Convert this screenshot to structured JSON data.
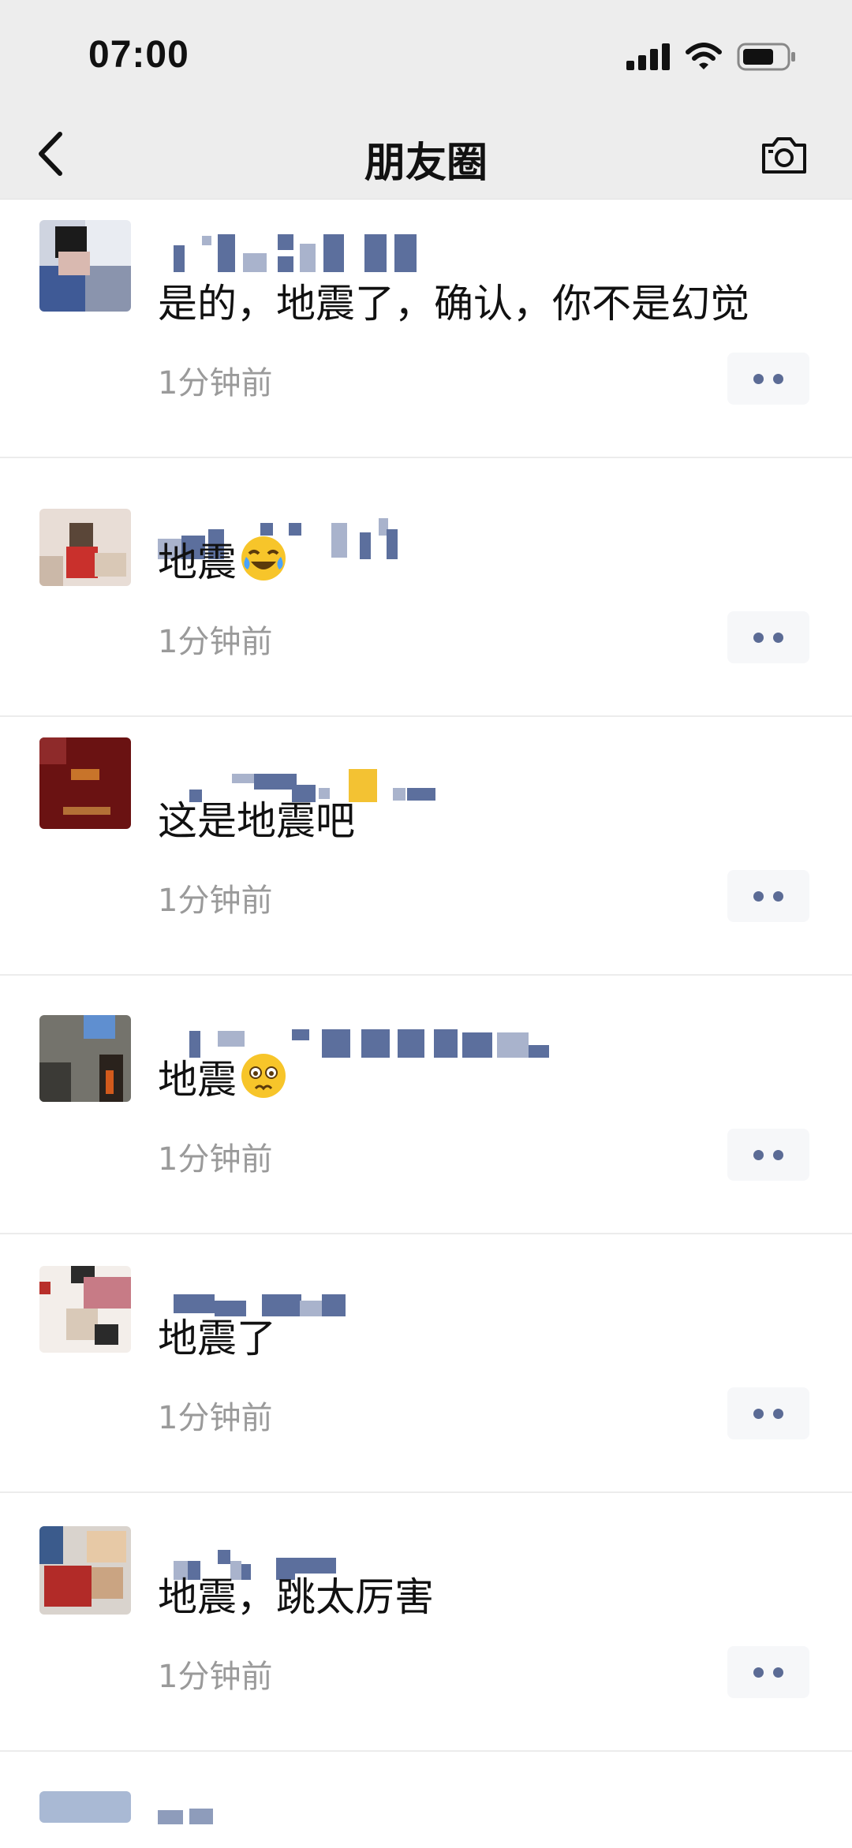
{
  "status_bar": {
    "time": "07:00"
  },
  "nav": {
    "title": "朋友圈",
    "back_icon": "chevron-left-icon",
    "camera_icon": "camera-icon"
  },
  "posts": [
    {
      "text": "是的，地震了，确认，你不是幻觉",
      "time": "1分钟前",
      "emoji": ""
    },
    {
      "text": "地震",
      "time": "1分钟前",
      "emoji": "crying-laughing-emoji"
    },
    {
      "text": "这是地震吧",
      "time": "1分钟前",
      "emoji": ""
    },
    {
      "text": "地震",
      "time": "1分钟前",
      "emoji": "worried-face-emoji"
    },
    {
      "text": "地震了",
      "time": "1分钟前",
      "emoji": ""
    },
    {
      "text": "地震，跳太厉害",
      "time": "1分钟前",
      "emoji": ""
    }
  ],
  "colors": {
    "nav_bg": "#ededed",
    "name_blue": "#5c6f9d",
    "meta_gray": "#9a9a9a",
    "more_button_bg": "#f6f7f9"
  }
}
